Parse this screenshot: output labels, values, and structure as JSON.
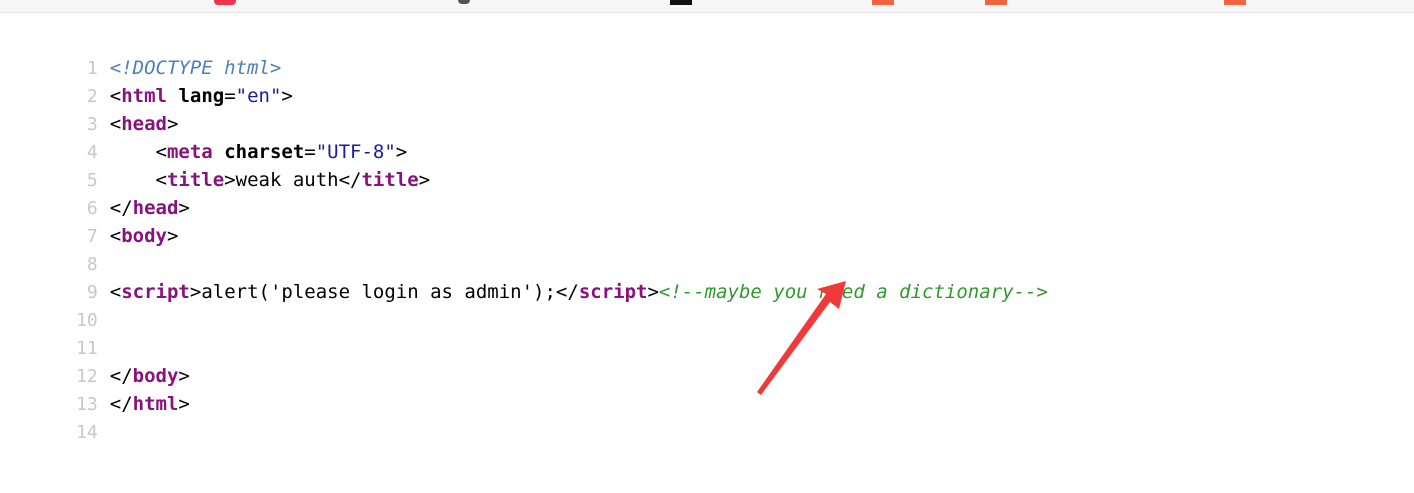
{
  "colors": {
    "tag": "#881280",
    "attribute_value": "#1a1aa6",
    "comment": "#2e9a2e",
    "doctype": "#4f7fb8",
    "line_number": "#c8c8c8",
    "arrow": "#f03a3a"
  },
  "lines": {
    "n1": "1",
    "n2": "2",
    "n3": "3",
    "n4": "4",
    "n5": "5",
    "n6": "6",
    "n7": "7",
    "n8": "8",
    "n9": "9",
    "n10": "10",
    "n11": "11",
    "n12": "12",
    "n13": "13",
    "n14": "14"
  },
  "source": {
    "doctype": "<!DOCTYPE html>",
    "html_tag": "html",
    "lang_attr": "lang",
    "lang_val": "\"en\"",
    "head_tag": "head",
    "meta_tag": "meta",
    "charset_attr": "charset",
    "charset_val": "\"UTF-8\"",
    "title_tag": "title",
    "title_text": "weak auth",
    "body_tag": "body",
    "script_tag": "script",
    "script_text": "alert('please login as admin');",
    "comment": "<!--maybe you need a dictionary-->"
  },
  "annotation": {
    "icon": "red-arrow-icon"
  }
}
